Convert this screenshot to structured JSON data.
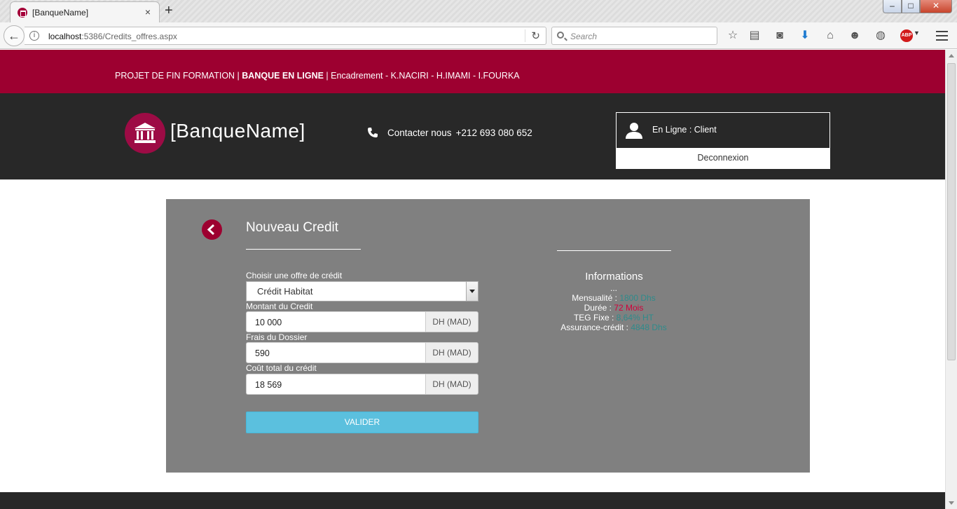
{
  "browser": {
    "tab_title": "[BanqueName]",
    "tab_close": "×",
    "new_tab": "+",
    "url_host": "localhost",
    "url_rest": ":5386/Credits_offres.aspx",
    "search_placeholder": "Search",
    "window_min": "–",
    "window_max": "□",
    "window_close": "✕",
    "abp_label": "ABP",
    "toolbar_icons": [
      "star-icon",
      "reading-list-icon",
      "pocket-icon",
      "download-icon",
      "home-icon",
      "chat-icon",
      "globe-icon",
      "adblock-icon",
      "menu-icon"
    ]
  },
  "topstrip": {
    "part1": "PROJET DE FIN FORMATION | ",
    "bold": "BANQUE EN LIGNE",
    "part2": " | Encadrement - K.NACIRI - H.IMAMI - I.FOURKA"
  },
  "header": {
    "brand": "[BanqueName]",
    "contact_label": "Contacter nous",
    "contact_phone": "+212 693 080 652",
    "online_status": "En Ligne : Client",
    "logout_label": "Deconnexion"
  },
  "form": {
    "title": "Nouveau Credit",
    "offer_label": "Choisir une offre de crédit",
    "offer_selected": "Crédit Habitat",
    "amount_label": "Montant du Credit",
    "amount_value": "10 000",
    "fees_label": "Frais du Dossier",
    "fees_value": "590",
    "total_label": "Coût total du crédit",
    "total_value": "18 569",
    "currency_addon": "DH (MAD)",
    "submit_label": "VALIDER"
  },
  "info": {
    "title": "Informations",
    "ellipsis": "...",
    "mensualite_label": "Mensualité : ",
    "mensualite_value": "1800 Dhs",
    "duree_label": "Durée : ",
    "duree_value": "72 Mois",
    "teg_label": "TEG Fixe : ",
    "teg_value": "8,64% HT",
    "assurance_label": "Assurance-crédit : ",
    "assurance_value": "4848 Dhs"
  },
  "colors": {
    "brand_red": "#9d0030",
    "header_dark": "#282828",
    "panel_gray": "#808080",
    "accent_teal": "#2e8b8b",
    "accent_red": "#d2003a",
    "button_blue": "#5bc0de"
  }
}
